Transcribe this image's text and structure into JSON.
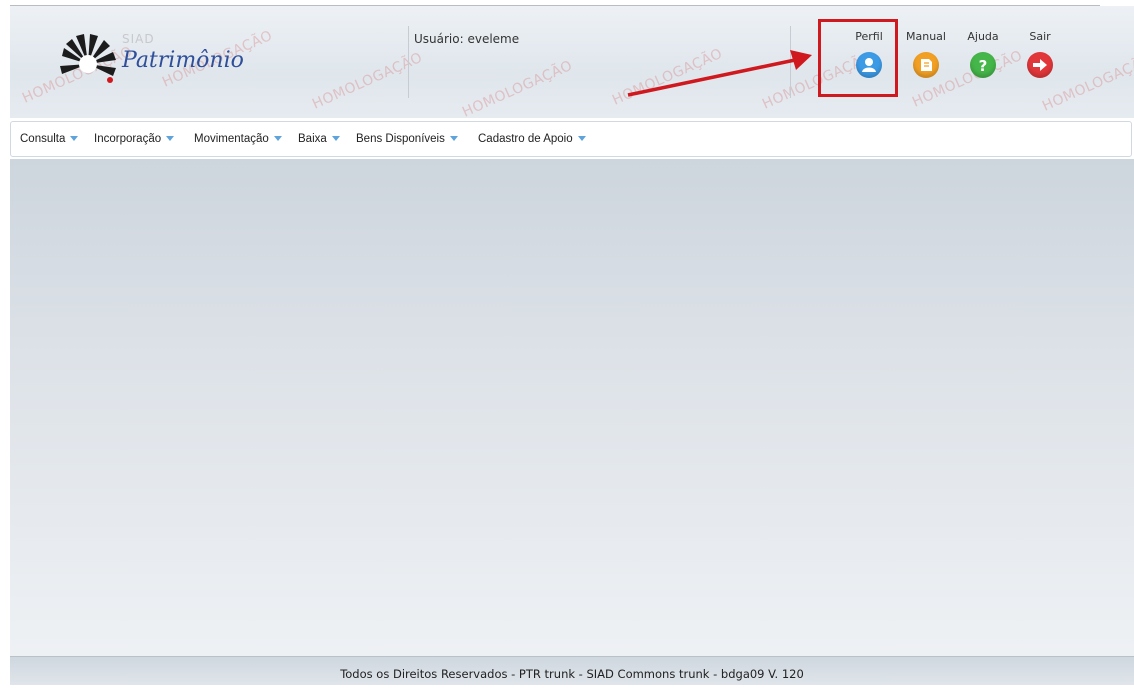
{
  "app": {
    "siad_label": "SIAD",
    "title": "Patrimônio",
    "user_label": "Usuário: eveleme"
  },
  "watermark_text": "HOMOLOGAÇÃO",
  "toolbar": {
    "items": [
      {
        "label": "Perfil",
        "icon": "user-icon",
        "color": "#3d9be6"
      },
      {
        "label": "Manual",
        "icon": "document-icon",
        "color": "#f2a024"
      },
      {
        "label": "Ajuda",
        "icon": "question-icon",
        "color": "#45b649"
      },
      {
        "label": "Sair",
        "icon": "exit-arrow-icon",
        "color": "#e2373a"
      }
    ]
  },
  "annotation": {
    "color": "#d0191e"
  },
  "menu": {
    "items": [
      {
        "label": "Consulta"
      },
      {
        "label": "Incorporação"
      },
      {
        "label": "Movimentação"
      },
      {
        "label": "Baixa"
      },
      {
        "label": "Bens Disponíveis"
      },
      {
        "label": "Cadastro de Apoio"
      }
    ]
  },
  "footer": {
    "text": "Todos os Direitos Reservados - PTR trunk - SIAD Commons trunk - bdga09 V. 120"
  }
}
